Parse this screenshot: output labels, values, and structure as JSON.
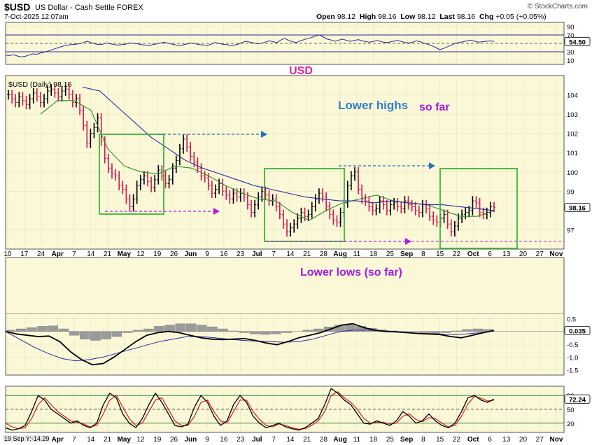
{
  "header": {
    "symbol": "$USD",
    "description": "US Dollar - Cash Settle FOREX",
    "date": "7-Oct-2025 12:07am",
    "open_label": "Open",
    "open": "98.12",
    "high_label": "High",
    "high": "98.16",
    "low_label": "Low",
    "low": "98.12",
    "last_label": "Last",
    "last": "98.16",
    "chg_label": "Chg",
    "chg": "+0.05 (+0.05%)",
    "credit": "© StockCharts.com"
  },
  "annotations": {
    "usd": "USD",
    "lower_highs": "Lower highs",
    "so_far": "so far",
    "lower_lows": "Lower lows (so far)"
  },
  "footnote": "19 Sep Y:-14.29",
  "colors": {
    "plot_bg": "#fbf8d8",
    "up_bar": "#000000",
    "down_bar": "#d6154e",
    "ma_fast": "#2e8b2e",
    "ma_slow": "#2a2a9a",
    "box": "#3ab53a",
    "arrow_high": "#2a6fb0",
    "arrow_low": "#b21ee0",
    "usd_text": "#e0209a",
    "lower_highs_text": "#2f7fc8",
    "purple_text": "#a11ee0"
  },
  "chart_data": [
    {
      "type": "line",
      "name": "RSI(14)",
      "ylim": [
        0,
        100
      ],
      "y_ticks": [
        "90",
        "70",
        "30",
        "10"
      ],
      "reference_lines": [
        70,
        30
      ],
      "last_value": "54.50",
      "values": [
        22,
        21,
        23,
        20,
        18,
        19,
        22,
        25,
        24,
        27,
        29,
        32,
        35,
        38,
        41,
        44,
        46,
        47,
        48,
        49,
        52,
        55,
        52,
        49,
        47,
        48,
        51,
        49,
        47,
        46,
        47,
        48,
        51,
        50,
        49,
        47,
        46,
        45,
        47,
        49,
        51,
        53,
        50,
        48,
        46,
        45,
        47,
        49,
        51,
        49,
        47,
        46,
        45,
        48,
        52,
        50,
        48,
        47,
        45,
        46,
        48,
        52,
        55,
        53,
        51,
        49,
        50,
        53,
        56,
        54,
        52,
        58,
        62,
        57,
        54,
        52,
        56,
        59,
        62,
        64,
        68,
        70,
        65,
        60,
        58,
        55,
        58,
        60,
        57,
        55,
        57,
        59,
        56,
        54,
        53,
        55,
        57,
        54,
        52,
        53,
        55,
        57,
        55,
        52,
        51,
        53,
        56,
        54,
        50,
        48,
        44,
        40,
        35,
        38,
        42,
        46,
        50,
        52,
        54,
        56,
        58,
        55,
        53,
        54,
        55,
        56,
        54.5
      ]
    },
    {
      "type": "line",
      "title": "$USD (Daily) 98.16",
      "ylim": [
        96,
        105
      ],
      "y_ticks": [
        "104",
        "103",
        "102",
        "101",
        "100",
        "99",
        "97"
      ],
      "last_value": "98.16",
      "x_tick_labels": [
        "10",
        "17",
        "24",
        "Apr",
        "7",
        "14",
        "21",
        "May",
        "12",
        "19",
        "26",
        "Jun",
        "9",
        "16",
        "23",
        "Jul",
        "7",
        "14",
        "21",
        "28",
        "Aug",
        "11",
        "18",
        "25",
        "Sep",
        "8",
        "15",
        "22",
        "Oct",
        "6",
        "13",
        "20",
        "27",
        "Nov"
      ],
      "series": [
        {
          "name": "$USD",
          "values": [
            104.0,
            103.8,
            103.6,
            103.9,
            103.7,
            103.5,
            103.8,
            104.1,
            103.9,
            103.6,
            103.8,
            104.2,
            104.3,
            104.1,
            103.9,
            104.2,
            104.3,
            104.0,
            103.6,
            103.8,
            103.2,
            102.4,
            101.5,
            102.0,
            102.3,
            102.8,
            101.6,
            100.7,
            100.2,
            99.9,
            99.8,
            99.3,
            99.1,
            98.6,
            98.2,
            98.6,
            99.3,
            99.6,
            99.8,
            99.5,
            99.2,
            99.6,
            100.1,
            99.8,
            99.4,
            99.6,
            100.2,
            100.6,
            101.2,
            101.7,
            101.3,
            100.8,
            100.5,
            100.2,
            99.8,
            99.7,
            99.3,
            98.9,
            99.1,
            99.4,
            99.0,
            98.8,
            98.6,
            98.9,
            98.7,
            98.9,
            98.7,
            98.3,
            97.9,
            98.3,
            98.7,
            99.0,
            98.8,
            98.5,
            98.6,
            98.2,
            97.8,
            97.3,
            96.9,
            97.1,
            97.3,
            97.6,
            97.9,
            97.7,
            97.8,
            98.2,
            98.6,
            98.9,
            98.7,
            98.2,
            97.8,
            97.5,
            97.4,
            97.9,
            98.4,
            99.3,
            99.8,
            100.0,
            99.1,
            98.6,
            98.5,
            98.2,
            98.0,
            98.1,
            98.5,
            98.3,
            98.0,
            98.3,
            98.4,
            98.2,
            98.1,
            98.5,
            98.3,
            98.2,
            98.0,
            97.9,
            98.3,
            98.1,
            97.7,
            97.5,
            97.4,
            97.6,
            97.8,
            97.3,
            96.9,
            97.2,
            97.6,
            97.8,
            97.9,
            98.0,
            98.5,
            98.4,
            97.9,
            97.8,
            97.9,
            98.2,
            98.16
          ]
        },
        {
          "name": "MA fast",
          "values": [
            103.0,
            103.7,
            103.7,
            103.2,
            101.2,
            100.3,
            100.0,
            99.9,
            100.3,
            100.2,
            99.8,
            99.3,
            98.9,
            98.6,
            98.5,
            97.9,
            97.5,
            98.0,
            98.4,
            98.6,
            98.8,
            98.5,
            98.4,
            98.3,
            98.0,
            97.7,
            97.7,
            98.0
          ]
        },
        {
          "name": "MA slow",
          "values": [
            104.4,
            104.2,
            103.4,
            102.6,
            101.8,
            101.2,
            100.6,
            100.2,
            99.9,
            99.6,
            99.3,
            99.1,
            98.9,
            98.7,
            98.6,
            98.5,
            98.5,
            98.4,
            98.5,
            98.4,
            98.3,
            98.3,
            98.2,
            98.1,
            98.0
          ]
        }
      ]
    },
    {
      "type": "line",
      "name": "MACD",
      "ylim": [
        -1.7,
        0.7
      ],
      "y_ticks": [
        "0.5",
        "-0.5",
        "-1.0",
        "-1.5"
      ],
      "last_value": "0.035",
      "series": [
        {
          "name": "MACD",
          "values": [
            0.0,
            -0.1,
            -0.15,
            -0.2,
            -0.18,
            -0.4,
            -0.8,
            -1.1,
            -1.3,
            -1.25,
            -1.0,
            -0.7,
            -0.4,
            -0.15,
            -0.05,
            0.0,
            -0.05,
            -0.15,
            -0.25,
            -0.3,
            -0.32,
            -0.3,
            -0.28,
            -0.35,
            -0.45,
            -0.52,
            -0.4,
            -0.25,
            -0.15,
            -0.05,
            0.1,
            0.25,
            0.3,
            0.15,
            0.05,
            0.0,
            -0.02,
            -0.05,
            -0.08,
            -0.1,
            -0.12,
            -0.2,
            -0.25,
            -0.15,
            -0.05,
            0.035
          ]
        },
        {
          "name": "Signal",
          "values": [
            0.0,
            -0.3,
            -0.6,
            -0.85,
            -1.05,
            -1.15,
            -1.1,
            -1.0,
            -0.85,
            -0.7,
            -0.55,
            -0.4,
            -0.3,
            -0.2,
            -0.2,
            -0.25,
            -0.3,
            -0.35,
            -0.38,
            -0.4,
            -0.42,
            -0.4,
            -0.3,
            -0.15,
            0.0,
            0.05,
            0.05,
            0.02,
            0.0,
            -0.05,
            -0.08,
            -0.1,
            -0.12,
            -0.1,
            -0.05,
            0.02
          ]
        },
        {
          "name": "Histogram",
          "values": [
            0.05,
            0.1,
            0.15,
            0.2,
            0.22,
            0.1,
            -0.15,
            -0.3,
            -0.35,
            -0.3,
            -0.2,
            -0.05,
            0.05,
            0.1,
            0.2,
            0.25,
            0.3,
            0.3,
            0.25,
            0.18,
            0.1,
            0.02,
            -0.05,
            -0.1,
            -0.12,
            -0.1,
            -0.05,
            0.0,
            0.05,
            0.1,
            0.18,
            0.25,
            0.25,
            0.2,
            0.12,
            0.06,
            0.02,
            0.0,
            -0.02,
            -0.05,
            -0.08,
            -0.05,
            0.02,
            0.08,
            0.1,
            0.08
          ]
        }
      ]
    },
    {
      "type": "line",
      "name": "Stochastic",
      "ylim": [
        0,
        100
      ],
      "y_ticks": [
        "80",
        "50",
        "20"
      ],
      "reference_lines": [
        80,
        50,
        20
      ],
      "last_value": "72.24",
      "series": [
        {
          "name": "%K",
          "values": [
            10,
            5,
            8,
            15,
            45,
            80,
            70,
            50,
            40,
            30,
            20,
            25,
            15,
            10,
            20,
            60,
            85,
            75,
            40,
            20,
            10,
            30,
            60,
            85,
            65,
            40,
            15,
            12,
            18,
            55,
            80,
            65,
            35,
            15,
            25,
            60,
            80,
            65,
            35,
            20,
            10,
            15,
            20,
            12,
            8,
            5,
            10,
            20,
            30,
            60,
            95,
            85,
            70,
            60,
            40,
            20,
            18,
            25,
            20,
            15,
            25,
            45,
            35,
            20,
            25,
            40,
            25,
            15,
            10,
            20,
            45,
            75,
            80,
            70,
            65,
            72
          ]
        },
        {
          "name": "%D",
          "values": [
            20,
            12,
            8,
            10,
            30,
            60,
            75,
            60,
            45,
            35,
            25,
            22,
            18,
            12,
            15,
            40,
            70,
            80,
            55,
            30,
            15,
            20,
            45,
            70,
            75,
            50,
            25,
            15,
            15,
            35,
            65,
            70,
            45,
            25,
            20,
            45,
            70,
            70,
            45,
            28,
            15,
            12,
            18,
            15,
            10,
            7,
            8,
            15,
            25,
            45,
            80,
            88,
            75,
            65,
            50,
            30,
            20,
            22,
            22,
            18,
            20,
            35,
            40,
            28,
            23,
            32,
            30,
            20,
            12,
            15,
            35,
            62,
            78,
            74,
            68,
            70
          ]
        }
      ]
    }
  ]
}
